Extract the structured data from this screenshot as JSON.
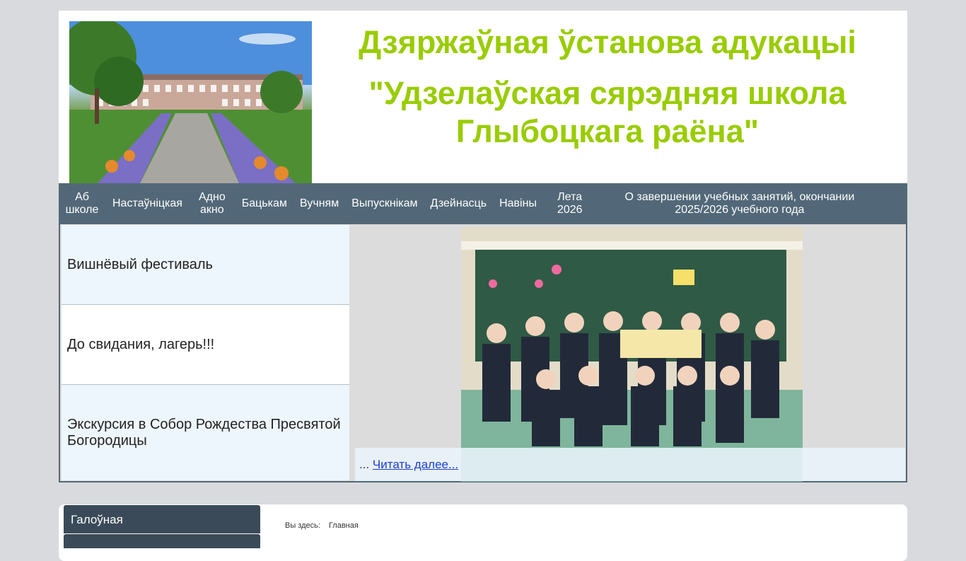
{
  "header": {
    "title_line1": "Дзяржаўная ўстанова адукацыі",
    "title_line2": "\"Удзелаўская сярэдняя школа Глыбоцкага раёна\""
  },
  "nav": [
    "Аб\nшколе",
    "Настаўніцкая",
    "Адно\nакно",
    "Бацькам",
    "Вучням",
    "Выпускнікам",
    "Дзейнасць",
    "Навіны",
    "Лета\n2026",
    "О завершении учебных занятий, окончании\n2025/2026 учебного года"
  ],
  "slider": {
    "items": [
      "Вишнёвый фестиваль",
      "До свидания, лагерь!!!",
      "Экскурсия в Собор Рождества Пресвятой Богородицы"
    ],
    "ellipsis": "...",
    "read_more": "Читать далее..."
  },
  "sidebar": {
    "first_item": "Галоўная"
  },
  "breadcrumb": {
    "prefix": "Вы здесь:",
    "current": "Главная"
  },
  "colors": {
    "title": "#99cc00",
    "nav_bg": "#526878",
    "page_bg": "#d9dadd"
  }
}
